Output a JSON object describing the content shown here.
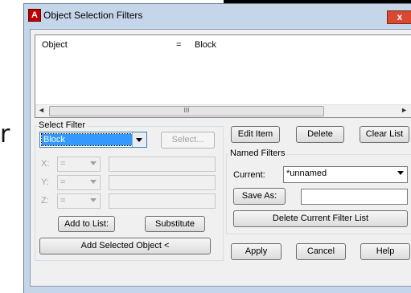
{
  "background": {
    "partial_letter": "r"
  },
  "window": {
    "title": "Object Selection Filters",
    "app_icon_letter": "A",
    "close_glyph": "x"
  },
  "list": {
    "rows": [
      {
        "object": "Object",
        "operator": "=",
        "value": "Block"
      }
    ],
    "scroll_thumb_grip": "III",
    "left_arrow": "◄",
    "right_arrow": "►"
  },
  "select_filter": {
    "group_label": "Select Filter",
    "type_value": "Block",
    "select_button": "Select...",
    "coords": [
      {
        "axis": "X:",
        "operator": "="
      },
      {
        "axis": "Y:",
        "operator": "="
      },
      {
        "axis": "Z:",
        "operator": "="
      }
    ],
    "add_to_list_button": "Add to List:",
    "substitute_button": "Substitute",
    "add_selected_button": "Add Selected Object <"
  },
  "edit_buttons": {
    "edit_item": "Edit Item",
    "delete": "Delete",
    "clear_list": "Clear List"
  },
  "named_filters": {
    "group_label": "Named Filters",
    "current_label": "Current:",
    "current_value": "*unnamed",
    "save_as_button": "Save As:",
    "save_as_value": "",
    "delete_current_button": "Delete Current Filter List"
  },
  "dialog_buttons": {
    "apply": "Apply",
    "cancel": "Cancel",
    "help": "Help"
  },
  "colors": {
    "frame": "#c5d6ea",
    "close_button": "#d9482f",
    "selection": "#3399ff",
    "app_icon": "#c00000"
  }
}
